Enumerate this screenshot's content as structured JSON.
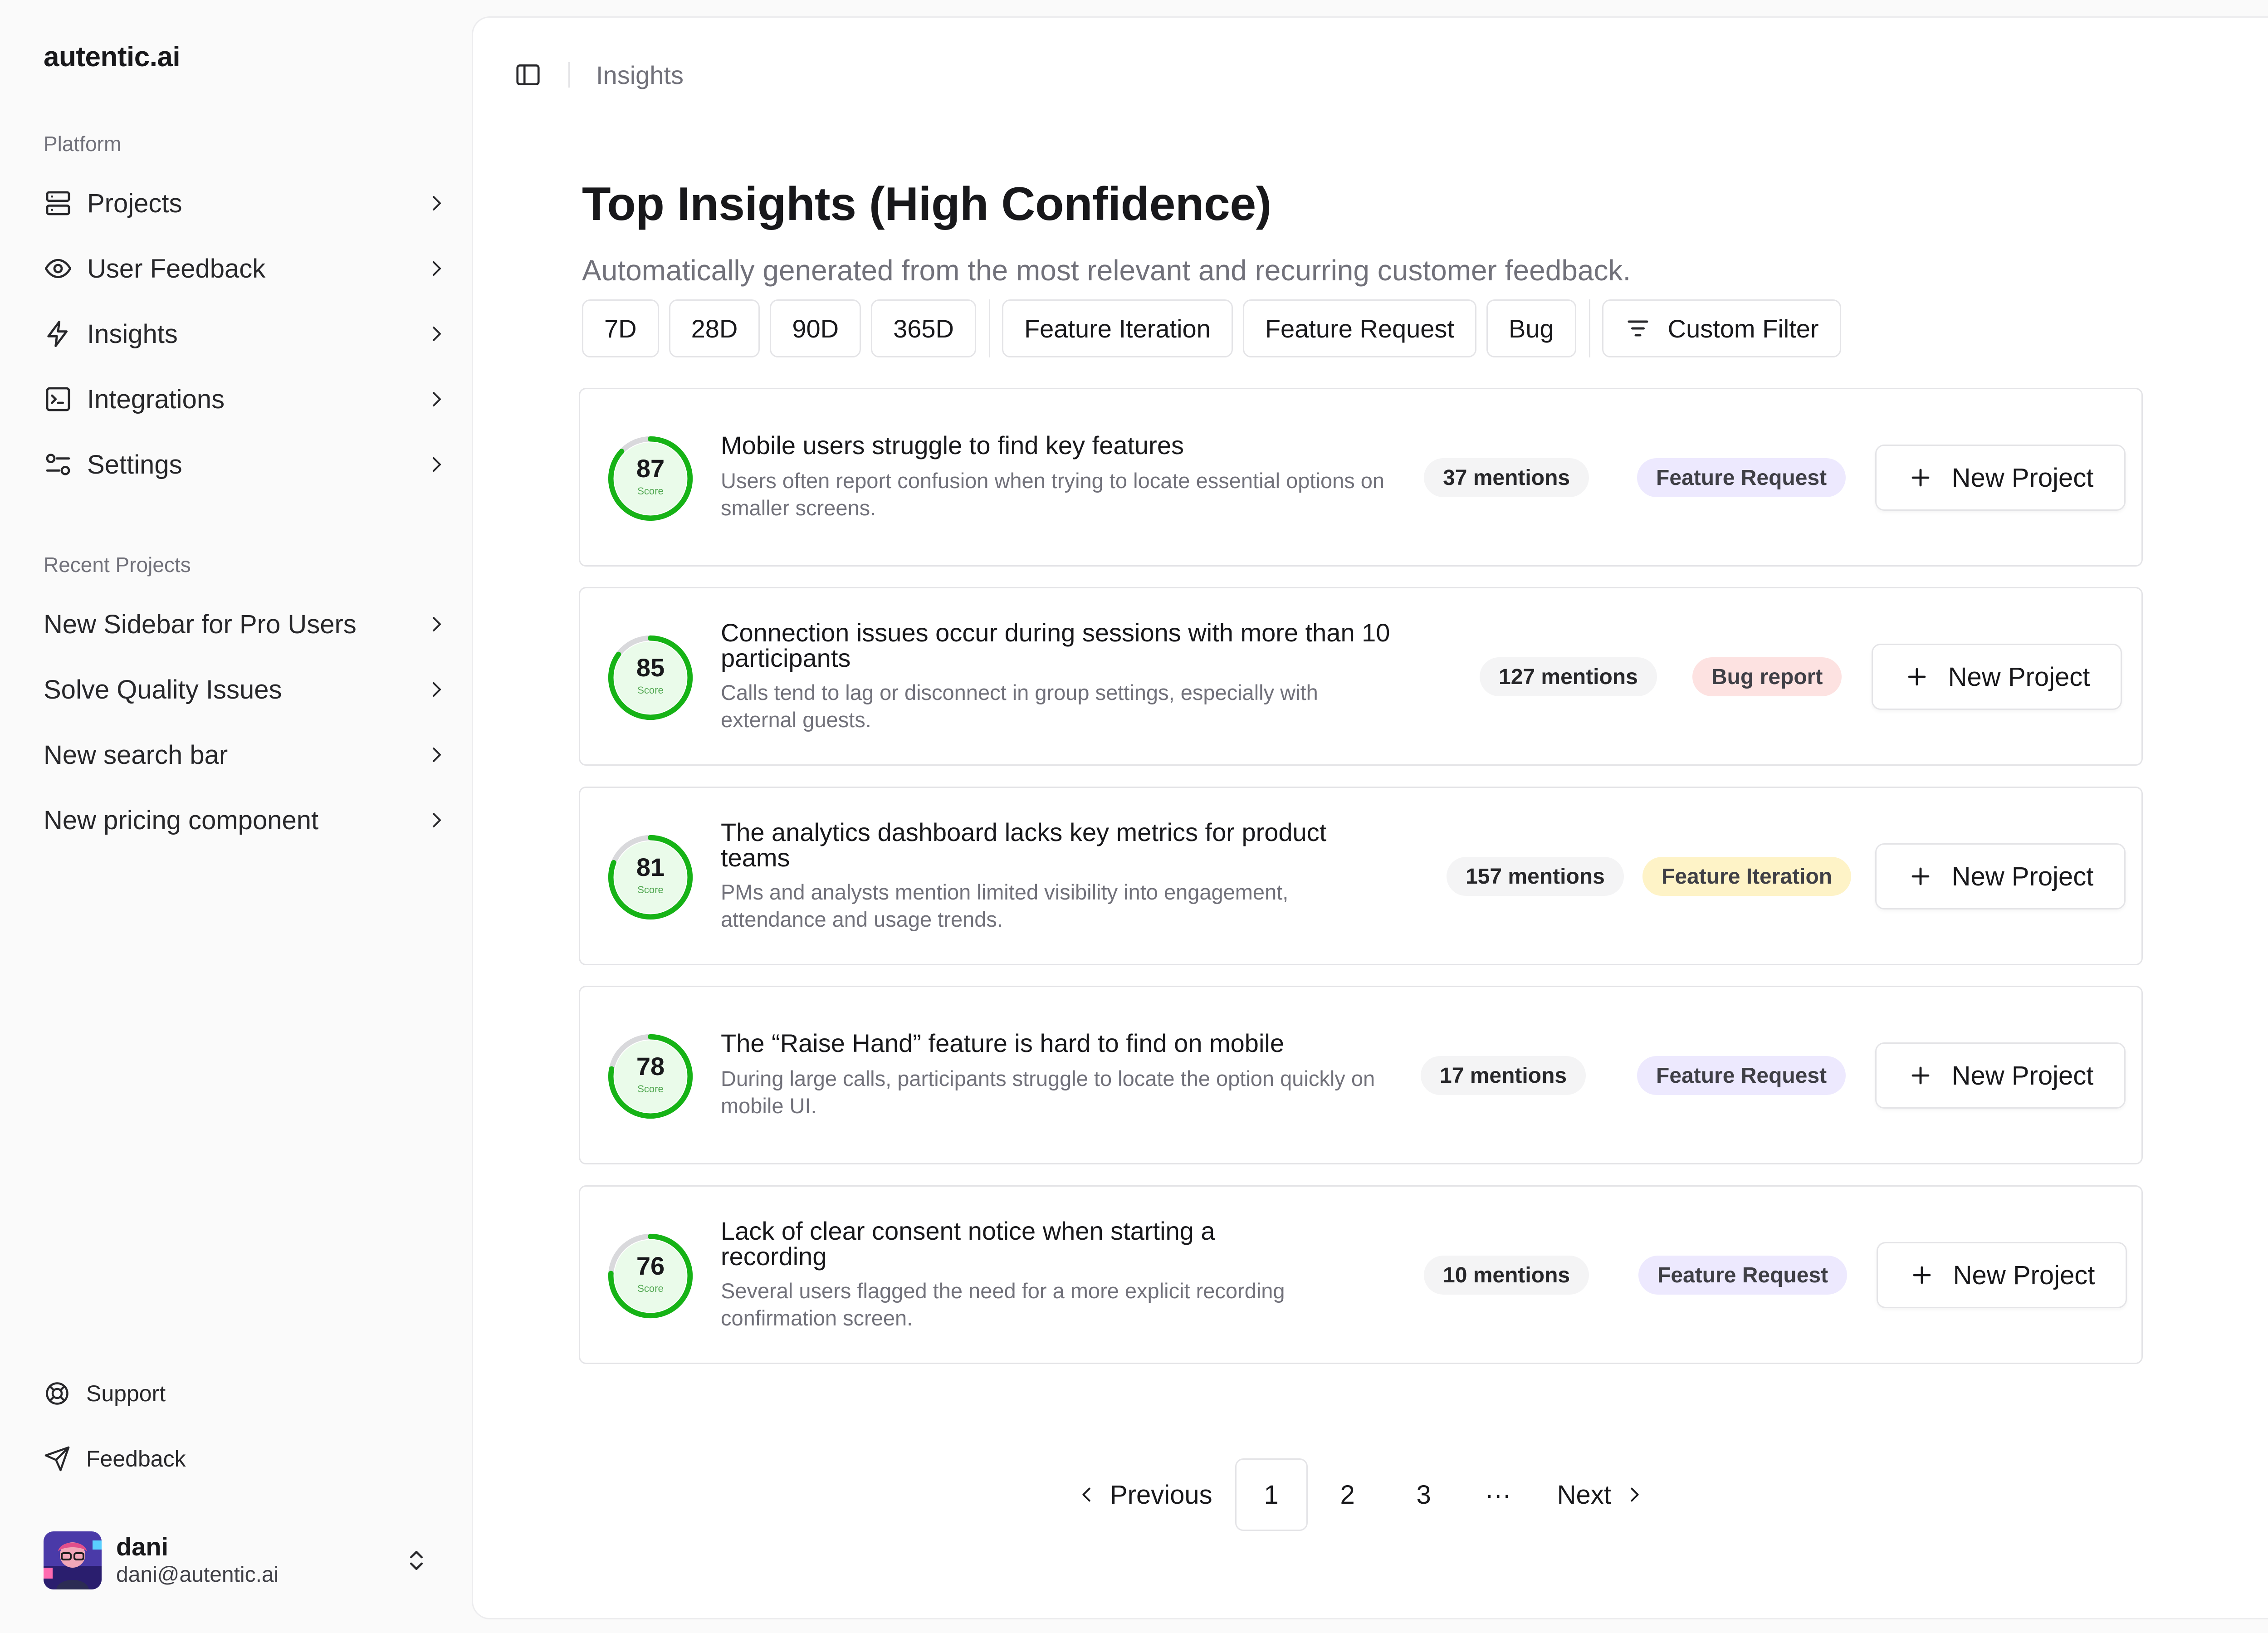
{
  "sidebar": {
    "brand": "autentic.ai",
    "platform_label": "Platform",
    "platform_items": [
      {
        "label": "Projects",
        "icon": "server-icon"
      },
      {
        "label": "User Feedback",
        "icon": "eye-icon"
      },
      {
        "label": "Insights",
        "icon": "bolt-icon"
      },
      {
        "label": "Integrations",
        "icon": "terminal-icon"
      },
      {
        "label": "Settings",
        "icon": "sliders-icon"
      }
    ],
    "recent_label": "Recent Projects",
    "recent_items": [
      {
        "label": "New Sidebar for Pro Users"
      },
      {
        "label": "Solve Quality Issues"
      },
      {
        "label": "New search bar"
      },
      {
        "label": "New pricing component"
      }
    ],
    "footer_items": [
      {
        "label": "Support",
        "icon": "lifebuoy-icon"
      },
      {
        "label": "Feedback",
        "icon": "send-icon"
      }
    ],
    "user": {
      "name": "dani",
      "email": "dani@autentic.ai"
    }
  },
  "topbar": {
    "breadcrumb": "Insights"
  },
  "main": {
    "title": "Top Insights (High Confidence)",
    "subtitle": "Automatically generated from the most relevant and recurring customer feedback.",
    "time_filters": [
      "7D",
      "28D",
      "90D",
      "365D"
    ],
    "type_filters": [
      "Feature Iteration",
      "Feature Request",
      "Bug"
    ],
    "custom_filter_label": "Custom Filter"
  },
  "insights": [
    {
      "score": 87,
      "score_label": "Score",
      "title": "Mobile users struggle to find key features",
      "description": "Users often report confusion when trying to locate essential options on smaller screens.",
      "mentions": "37 mentions",
      "tag": "Feature Request",
      "tag_kind": "request",
      "action": "New Project"
    },
    {
      "score": 85,
      "score_label": "Score",
      "title": "Connection issues occur during sessions with more than 10 participants",
      "description": "Calls tend to lag or disconnect in group settings, especially with external guests.",
      "mentions": "127 mentions",
      "tag": "Bug report",
      "tag_kind": "bug",
      "action": "New Project"
    },
    {
      "score": 81,
      "score_label": "Score",
      "title": "The analytics dashboard lacks key metrics for product teams",
      "description": "PMs and analysts mention limited visibility into engagement, attendance and usage trends.",
      "mentions": "157 mentions",
      "tag": "Feature Iteration",
      "tag_kind": "iteration",
      "action": "New Project"
    },
    {
      "score": 78,
      "score_label": "Score",
      "title": "The “Raise Hand” feature is hard to find on mobile",
      "description": "During large calls, participants struggle to locate the option quickly on mobile UI.",
      "mentions": "17 mentions",
      "tag": "Feature Request",
      "tag_kind": "request",
      "action": "New Project"
    },
    {
      "score": 76,
      "score_label": "Score",
      "title": "Lack of clear consent notice when starting a recording",
      "description": "Several users flagged the need for a more explicit recording confirmation screen.",
      "mentions": "10 mentions",
      "tag": "Feature Request",
      "tag_kind": "request",
      "action": "New Project"
    }
  ],
  "pagination": {
    "previous": "Previous",
    "pages": [
      "1",
      "2",
      "3"
    ],
    "current": "1",
    "ellipsis": "···",
    "next": "Next"
  },
  "colors": {
    "score_ring": "#16b316",
    "score_track": "#d9d9dc",
    "score_fill_bg": "#eafbea"
  }
}
